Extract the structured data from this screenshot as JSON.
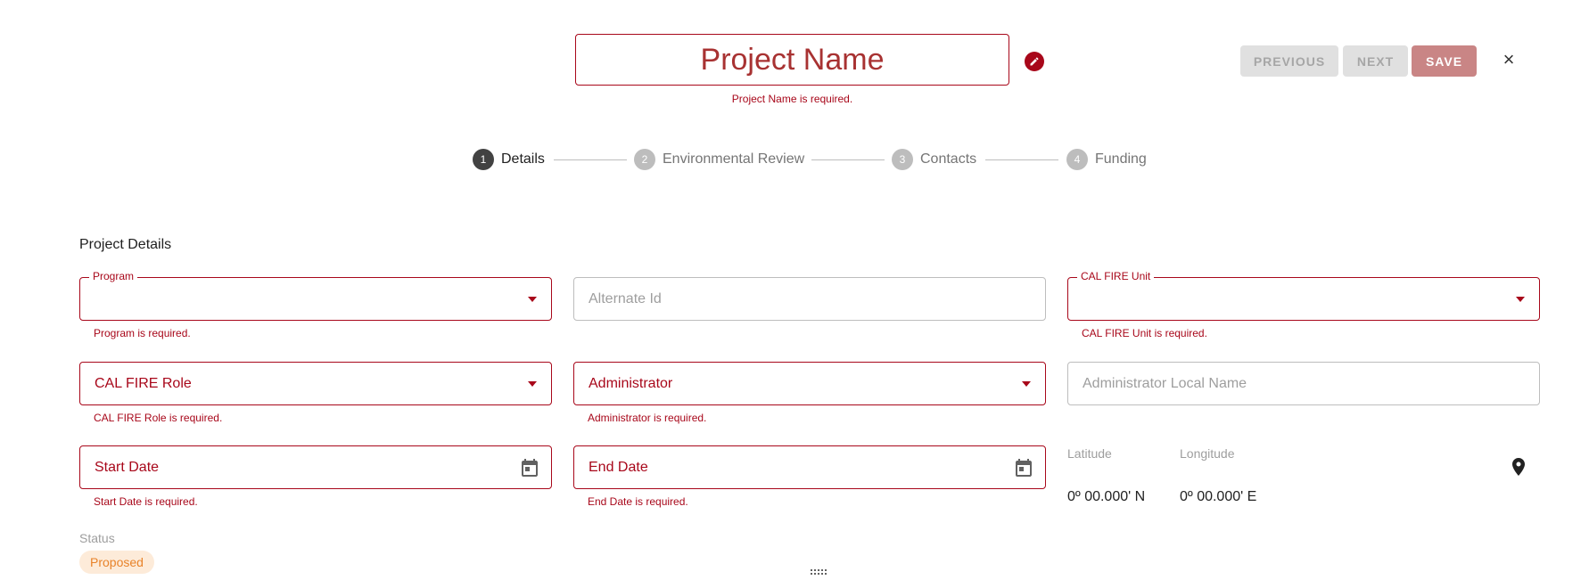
{
  "header": {
    "title": "Project Name",
    "title_error": "Project Name is required.",
    "previous_label": "PREVIOUS",
    "next_label": "NEXT",
    "save_label": "SAVE",
    "close_label": "×",
    "edit_icon": "pencil-icon"
  },
  "stepper": {
    "steps": [
      {
        "number": "1",
        "label": "Details",
        "active": true
      },
      {
        "number": "2",
        "label": "Environmental Review",
        "active": false
      },
      {
        "number": "3",
        "label": "Contacts",
        "active": false
      },
      {
        "number": "4",
        "label": "Funding",
        "active": false
      }
    ]
  },
  "section": {
    "title": "Project Details"
  },
  "fields": {
    "program": {
      "label": "Program",
      "value": "",
      "error": "Program is required."
    },
    "alternate_id": {
      "placeholder": "Alternate Id"
    },
    "cal_fire_unit": {
      "label": "CAL FIRE Unit",
      "value": "",
      "error": "CAL FIRE Unit is required."
    },
    "cal_fire_role": {
      "text": "CAL FIRE Role",
      "error": "CAL FIRE Role is required."
    },
    "administrator": {
      "text": "Administrator",
      "error": "Administrator is required."
    },
    "administrator_local_name": {
      "placeholder": "Administrator Local Name"
    },
    "start_date": {
      "text": "Start Date",
      "error": "Start Date is required."
    },
    "end_date": {
      "text": "End Date",
      "error": "End Date is required."
    }
  },
  "location": {
    "latitude_label": "Latitude",
    "longitude_label": "Longitude",
    "latitude_value": "0º 00.000' N",
    "longitude_value": "0º 00.000' E",
    "pin_icon": "map-pin-icon"
  },
  "status": {
    "label": "Status",
    "value": "Proposed"
  },
  "colors": {
    "error": "#a8071a",
    "title_text": "#a83232",
    "save_button": "#c98585",
    "disabled_button": "#e0e0e0",
    "status_chip_bg": "#fdebd9",
    "status_chip_text": "#e8832a"
  }
}
